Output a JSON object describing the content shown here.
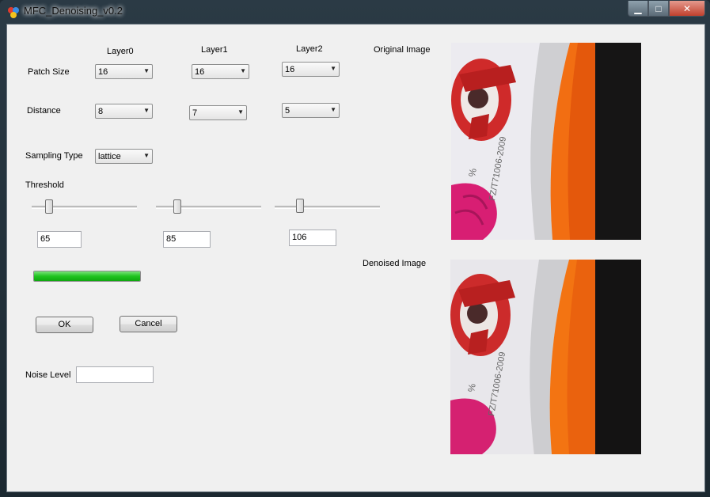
{
  "window": {
    "title": "MFC_Denoising_v0.2",
    "controls": {
      "minimize": "▁",
      "maximize": "□",
      "close": "✕"
    }
  },
  "layers": {
    "headers": [
      "Layer0",
      "Layer1",
      "Layer2"
    ]
  },
  "patch_size": {
    "label": "Patch Size",
    "values": [
      "16",
      "16",
      "16"
    ]
  },
  "distance": {
    "label": "Distance",
    "values": [
      "8",
      "7",
      "5"
    ]
  },
  "sampling": {
    "label": "Sampling Type",
    "value": "lattice"
  },
  "threshold": {
    "label": "Threshold",
    "values": [
      "65",
      "85",
      "106"
    ]
  },
  "progress": {
    "value": 1.0
  },
  "buttons": {
    "ok": "OK",
    "cancel": "Cancel"
  },
  "noise": {
    "label": "Noise Level",
    "value": ""
  },
  "images": {
    "original_label": "Original Image",
    "denoised_label": "Denoised Image",
    "product_code": "FZ/T71006-2009",
    "percent_sign": "%"
  },
  "colors": {
    "progress_green": "#1fc41f",
    "client_bg": "#f0f0f0"
  }
}
